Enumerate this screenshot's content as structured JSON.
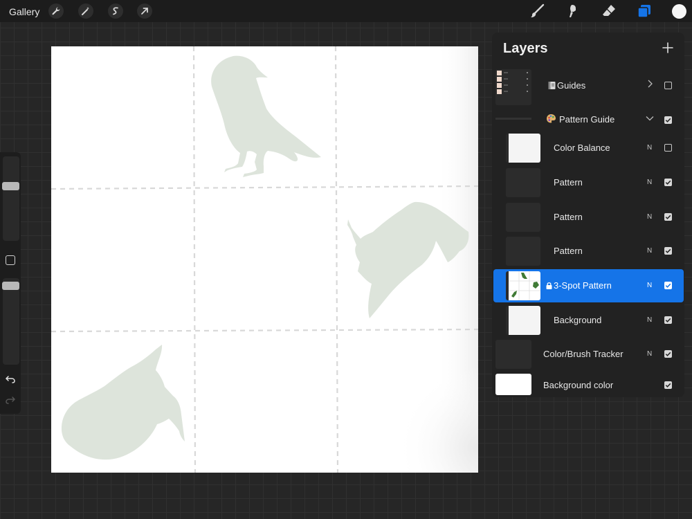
{
  "toolbar": {
    "gallery_label": "Gallery",
    "left_tools": [
      "wrench-icon",
      "magic-wand-icon",
      "selection-icon",
      "transform-arrow-icon"
    ],
    "right_tools": [
      "brush-icon",
      "smudge-icon",
      "eraser-icon",
      "layers-icon"
    ],
    "current_color": "#f5f5f5",
    "accent": "#1574e8"
  },
  "canvas": {
    "background": "#ffffff",
    "silhouette_color": "#dde4db",
    "guide_color": "#d8d8d8"
  },
  "layers_panel": {
    "title": "Layers",
    "layers": [
      {
        "name": "Guides",
        "icon": "notebook-emoji",
        "kind": "group-collapsed",
        "visible": false
      },
      {
        "name": "Pattern Guide",
        "icon": "palette-emoji",
        "kind": "group-expanded",
        "visible": true
      },
      {
        "name": "Color Balance",
        "blend": "N",
        "visible": false
      },
      {
        "name": "Pattern",
        "blend": "N",
        "visible": true
      },
      {
        "name": "Pattern",
        "blend": "N",
        "visible": true
      },
      {
        "name": "Pattern",
        "blend": "N",
        "visible": true
      },
      {
        "name": "3-Spot Pattern",
        "blend": "N",
        "visible": true,
        "selected": true,
        "locked": true
      },
      {
        "name": "Background",
        "blend": "N",
        "visible": true
      },
      {
        "name": "Color/Brush Tracker",
        "blend": "N",
        "visible": true
      },
      {
        "name": "Background color",
        "visible": true
      }
    ]
  }
}
